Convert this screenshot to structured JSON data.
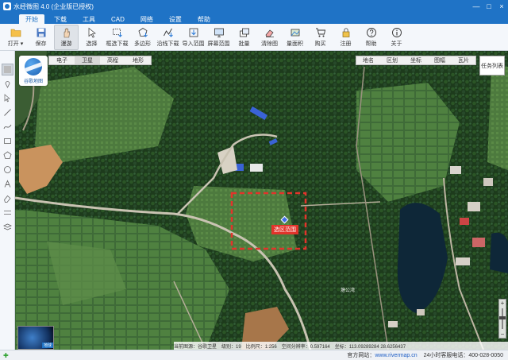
{
  "window": {
    "title": "水经微图 4.0 (企业版已授权)",
    "buttons": [
      "—",
      "□",
      "×"
    ]
  },
  "menu": {
    "tabs": [
      {
        "label": "开始",
        "active": true
      },
      {
        "label": "下载",
        "active": false
      },
      {
        "label": "工具",
        "active": false
      },
      {
        "label": "CAD",
        "active": false
      },
      {
        "label": "网络",
        "active": false
      },
      {
        "label": "设置",
        "active": false
      },
      {
        "label": "帮助",
        "active": false
      }
    ]
  },
  "toolbar": {
    "items": [
      {
        "label": "打开 ▾",
        "icon": "folder-icon"
      },
      {
        "label": "保存",
        "icon": "save-icon"
      },
      {
        "label": "漫游",
        "icon": "hand-icon",
        "selected": true
      },
      {
        "label": "选择",
        "icon": "pointer-icon"
      },
      {
        "label": "框选下载",
        "icon": "rect-download-icon"
      },
      {
        "label": "多边形",
        "icon": "polygon-icon"
      },
      {
        "label": "沿线下载",
        "icon": "polyline-icon"
      },
      {
        "label": "导入范围",
        "icon": "import-icon"
      },
      {
        "label": "屏幕范围",
        "icon": "screen-icon"
      },
      {
        "label": "批量",
        "icon": "batch-icon"
      },
      {
        "label": "清除图",
        "icon": "clear-icon"
      },
      {
        "label": "量面积",
        "icon": "area-icon"
      },
      {
        "label": "购买",
        "icon": "cart-icon"
      },
      {
        "label": "注册",
        "icon": "lock-icon"
      },
      {
        "label": "帮助",
        "icon": "help-icon"
      },
      {
        "label": "关于",
        "icon": "info-icon"
      }
    ]
  },
  "map": {
    "logo_text": "谷歌地图",
    "types": [
      {
        "label": "电子",
        "active": false
      },
      {
        "label": "卫星",
        "active": true
      },
      {
        "label": "高程",
        "active": false
      },
      {
        "label": "地形",
        "active": false
      }
    ],
    "overlays": [
      "地名",
      "区划",
      "坐标",
      "图幅",
      "瓦片"
    ],
    "task_button": "任务列表",
    "selection_label": "选区范围",
    "places": [
      "塘公湾"
    ],
    "globe_label": "地球",
    "zoom": {
      "plus": "+",
      "minus": "−",
      "level_fraction": 0.62
    },
    "info": {
      "source": "当前图源：谷歌卫星",
      "level": "级别：19",
      "scale": "比例尺：1:256",
      "resolution": "空间分辨率：0.597164",
      "coord": "坐标：113.09289284 28.6256437"
    }
  },
  "status": {
    "website_label": "官方网站：",
    "website": "www.rivermap.cn",
    "hotline": "24小时客服电话：400-028-0050"
  }
}
